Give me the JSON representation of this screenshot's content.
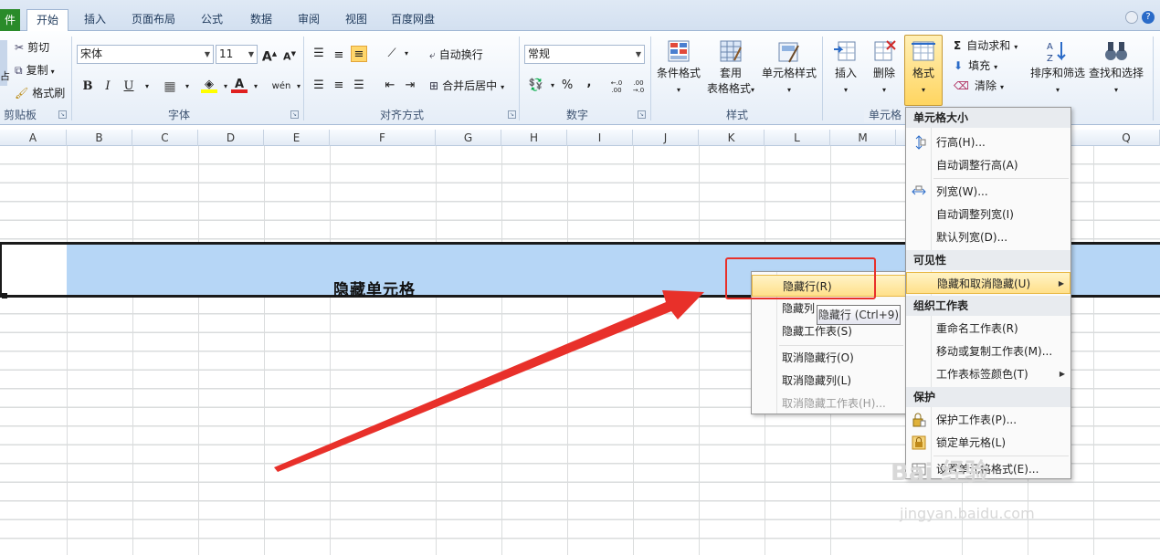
{
  "tabs": {
    "file": "件",
    "home": "开始",
    "insert": "插入",
    "layout": "页面布局",
    "formula": "公式",
    "data": "数据",
    "review": "审阅",
    "view": "视图",
    "baidu": "百度网盘"
  },
  "clipboard": {
    "paste_partial": "占",
    "cut": "剪切",
    "copy": "复制",
    "format_painter": "格式刷",
    "label": "剪贴板"
  },
  "font": {
    "name": "宋体",
    "size": "11",
    "grow": "A",
    "shrink": "A",
    "bold": "B",
    "italic": "I",
    "underline": "U",
    "font_color_glyph": "A",
    "phonetic": "wén",
    "label": "字体"
  },
  "alignment": {
    "wrap": "自动换行",
    "merge": "合并后居中",
    "label": "对齐方式"
  },
  "number": {
    "format": "常规",
    "percent": "%",
    "comma": ",",
    "inc_decimal": "←.0 .00",
    "dec_decimal": ".00 →.0",
    "label": "数字"
  },
  "styles": {
    "conditional": "条件格式",
    "table_line1": "套用",
    "table_line2": "表格格式",
    "cell_styles": "单元格样式",
    "label": "样式"
  },
  "cells": {
    "insert": "插入",
    "delete": "删除",
    "format": "格式",
    "label": "单元格"
  },
  "editing": {
    "autosum": "自动求和",
    "fill": "填充",
    "clear": "清除",
    "sort": "排序和筛选",
    "find": "查找和选择"
  },
  "columns": [
    "A",
    "B",
    "C",
    "D",
    "E",
    "F",
    "G",
    "H",
    "I",
    "J",
    "K",
    "L",
    "M",
    "Q"
  ],
  "cell_text": "隐藏单元格",
  "format_menu": {
    "section_size": "单元格大小",
    "row_height": "行高(H)...",
    "autofit_row": "自动调整行高(A)",
    "col_width": "列宽(W)...",
    "autofit_col": "自动调整列宽(I)",
    "default_width": "默认列宽(D)...",
    "section_visibility": "可见性",
    "hide_unhide": "隐藏和取消隐藏(U)",
    "section_organize": "组织工作表",
    "rename": "重命名工作表(R)",
    "move_copy": "移动或复制工作表(M)...",
    "tab_color": "工作表标签颜色(T)",
    "section_protect": "保护",
    "protect_sheet": "保护工作表(P)...",
    "lock_cell": "锁定单元格(L)",
    "format_cells": "设置单元格格式(E)..."
  },
  "hide_menu": {
    "hide_rows": "隐藏行(R)",
    "hide_cols": "隐藏列",
    "hide_sheet": "隐藏工作表(S)",
    "unhide_rows": "取消隐藏行(O)",
    "unhide_cols": "取消隐藏列(L)",
    "unhide_sheet": "取消隐藏工作表(H)..."
  },
  "tooltip": "隐藏行 (Ctrl+9)",
  "watermark": {
    "main": "Bai 经验",
    "sub": "jingyan.baidu.com"
  },
  "colors": {
    "accent_red": "#e8302a",
    "selected_row": "#b6d6f6",
    "menu_highlight": "#ffe08a"
  }
}
